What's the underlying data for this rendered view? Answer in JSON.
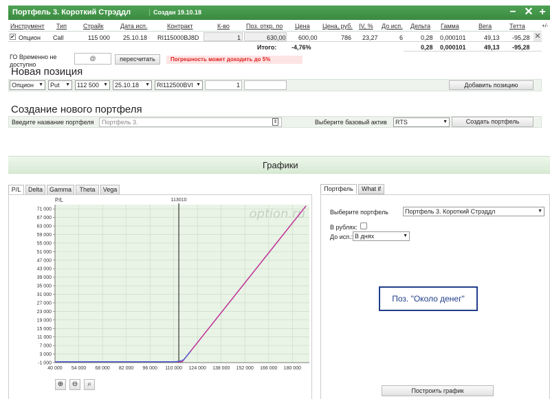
{
  "portfolio": {
    "title": "Портфель 3. Короткий Стрэддл",
    "created": "Создан 19.10.18",
    "controls": {
      "minimize": "−",
      "close": "✕",
      "add": "+",
      "more": "+/-"
    }
  },
  "table": {
    "headers": [
      "Инструмент",
      "Тип",
      "Страйк",
      "Дата исп.",
      "Контракт",
      "К-во",
      "Поз. откр. по",
      "Цена",
      "Цена, руб.",
      "IV, %",
      "До исп.",
      "Дельта",
      "Гамма",
      "Вега",
      "Тетта"
    ],
    "row": {
      "instrument": "Опцион",
      "type": "Call",
      "strike": "115 000",
      "date": "25.10.18",
      "contract": "RI115000BJ8D",
      "qty": "1",
      "open_price": "630,00",
      "price": "600,00",
      "price_rub": "786",
      "iv": "23,27",
      "days": "6",
      "delta": "0,28",
      "gamma": "0,000101",
      "vega": "49,13",
      "theta": "-95,28",
      "remove": "✕"
    },
    "totals": {
      "label": "Итого:",
      "price": "-4,76%",
      "delta": "0,28",
      "gamma": "0,000101",
      "vega": "49,13",
      "theta": "-95,28"
    }
  },
  "go": {
    "label": "ГО Временно не доступно",
    "value": "@",
    "recalc": "пересчитать",
    "warning": "Погрешность может доходить до 5%"
  },
  "new_position": {
    "title": "Новая позиция",
    "instrument": "Опцион",
    "type": "Put",
    "strike": "112 500",
    "date": "25.10.18",
    "contract": "RI112500BVI",
    "qty": "1",
    "add": "Добавить позицию"
  },
  "new_portfolio": {
    "title": "Создание нового портфеля",
    "name_label": "Введите название портфеля",
    "name_placeholder": "Портфель 3.",
    "base_label": "Выберите базовый актив",
    "base_value": "RTS",
    "create": "Создать портфель"
  },
  "charts": {
    "title": "Графики",
    "tabs": [
      "P/L",
      "Delta",
      "Gamma",
      "Theta",
      "Vega"
    ],
    "active_tab": "P/L",
    "ylabel": "P/L",
    "marker": "113010",
    "watermark": "option.ru",
    "zoom": [
      "zoom-in-icon",
      "zoom-out-icon",
      "zoom-reset-icon"
    ]
  },
  "right_panel": {
    "tabs": [
      "Портфель",
      "What if"
    ],
    "portfolio_label": "Выберите портфель",
    "portfolio_value": "Портфель 3. Короткий Стрэддл",
    "rub_label": "В рублях:",
    "expiry_label": "До исп.:",
    "expiry_value": "В днях",
    "callout": "Поз. \"Около денег\"",
    "build": "Построить график"
  },
  "chart_data": {
    "type": "line",
    "ylabel": "P/L",
    "xlim": [
      40000,
      190000
    ],
    "ylim": [
      -1000,
      73000
    ],
    "x_ticks": [
      40000,
      54000,
      68000,
      82000,
      96000,
      110000,
      124000,
      138000,
      152000,
      166000,
      180000
    ],
    "y_ticks": [
      -1000,
      3000,
      7000,
      11000,
      15000,
      19000,
      23000,
      27000,
      31000,
      35000,
      39000,
      43000,
      47000,
      51000,
      55000,
      59000,
      63000,
      67000,
      71000
    ],
    "x_tick_labels": [
      "40 000",
      "54 000",
      "68 000",
      "82 000",
      "96 000",
      "110 000",
      "124 000",
      "138 000",
      "152 000",
      "166 000",
      "180 000"
    ],
    "y_tick_labels": [
      "-1 000",
      "3 000",
      "7 000",
      "11 000",
      "15 000",
      "19 000",
      "23 000",
      "27 000",
      "31 000",
      "35 000",
      "39 000",
      "43 000",
      "47 000",
      "51 000",
      "55 000",
      "59 000",
      "63 000",
      "67 000",
      "71 000"
    ],
    "vline": 113010,
    "series": [
      {
        "color": "#c0399a",
        "x": [
          40000,
          115000,
          188000
        ],
        "y": [
          -600,
          -600,
          72400
        ]
      },
      {
        "color": "#3b5bdb",
        "x": [
          40000,
          110000,
          113000,
          116000,
          120000
        ],
        "y": [
          -600,
          -600,
          -400,
          400,
          4300
        ]
      }
    ],
    "grid": true
  },
  "colors": {
    "accent": "#3f9345",
    "warning_bg": "#fde4e4",
    "warning_text": "#e02020",
    "chart_bg": "#e9f3e6",
    "callout_border": "#1f3c88"
  }
}
